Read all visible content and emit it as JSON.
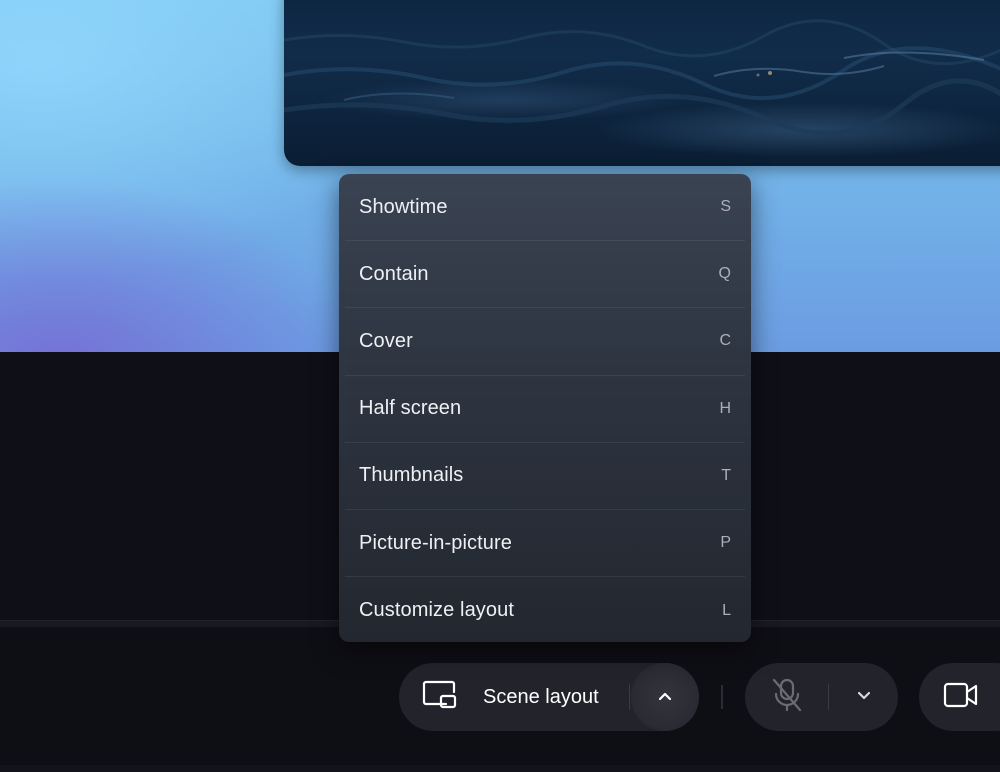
{
  "layout_menu": {
    "items": [
      {
        "label": "Showtime",
        "shortcut": "S"
      },
      {
        "label": "Contain",
        "shortcut": "Q"
      },
      {
        "label": "Cover",
        "shortcut": "C"
      },
      {
        "label": "Half screen",
        "shortcut": "H"
      },
      {
        "label": "Thumbnails",
        "shortcut": "T"
      },
      {
        "label": "Picture-in-picture",
        "shortcut": "P"
      },
      {
        "label": "Customize layout",
        "shortcut": "L"
      }
    ]
  },
  "toolbar": {
    "scene_layout_label": "Scene layout",
    "icons": {
      "scene_layout": "scene-layout-icon",
      "scene_chevron": "chevron-up-icon",
      "mic": "microphone-muted-icon",
      "mic_chevron": "chevron-down-icon",
      "camera": "video-camera-icon"
    }
  },
  "colors": {
    "menu_background": "#2d3440",
    "toolbar_pill": "#23232c",
    "page_background": "#0f0f17",
    "icon_muted": "#6b6b75"
  }
}
